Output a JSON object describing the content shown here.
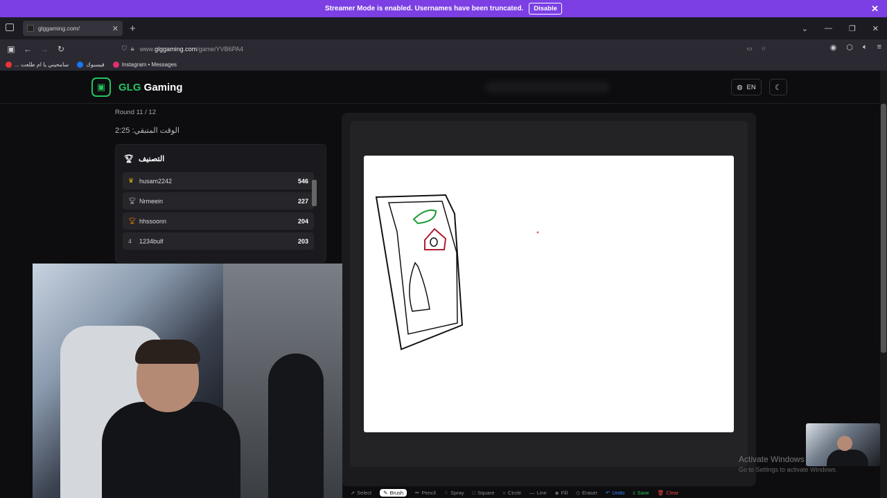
{
  "banner": {
    "message": "Streamer Mode is enabled. Usernames have been truncated.",
    "disable_label": "Disable"
  },
  "browser": {
    "tab_title": "glggaming.com/",
    "url_prefix": "www.",
    "url_domain": "glggaming.com",
    "url_path": "/game/YVB6PA4",
    "bookmarks": [
      "... سامحيني يا ام طلعت",
      "فيسبوك",
      "Instagram • Messages"
    ]
  },
  "site": {
    "brand_prefix": "GLG",
    "brand_suffix": " Gaming",
    "lang_label": "EN",
    "round_text": "Round 11 / 12",
    "timer_text": "الوقت المتبقي: 2:25",
    "leaderboard_title": "التصنيف",
    "players": [
      {
        "rank": "",
        "name": "husam2242",
        "score": "546"
      },
      {
        "rank": "",
        "name": "Nrmeein",
        "score": "227"
      },
      {
        "rank": "",
        "name": "hhssoonn",
        "score": "204"
      },
      {
        "rank": "4",
        "name": "1234bulf",
        "score": "203"
      }
    ]
  },
  "toolbar": [
    "Select",
    "Brush",
    "Pencil",
    "Spray",
    "Square",
    "Circle",
    "Line",
    "Fill",
    "Eraser",
    "Undo",
    "Save",
    "Clear"
  ],
  "watermark": {
    "line1": "Activate Windows",
    "line2": "Go to Settings to activate Windows."
  },
  "colors": {
    "accent": "#22c55e",
    "banner": "#7b3fe4"
  }
}
